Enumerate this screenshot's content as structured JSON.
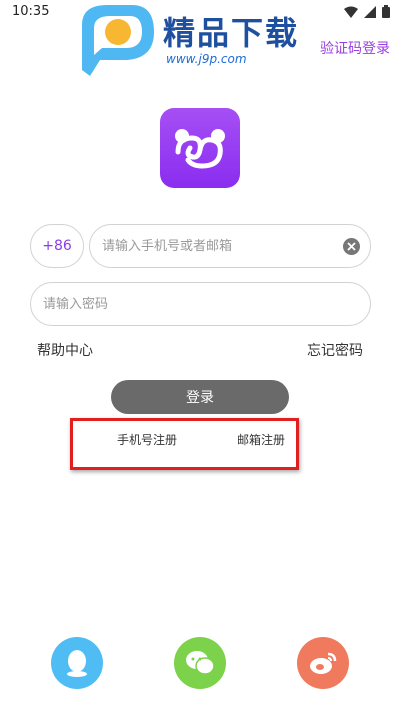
{
  "status_bar": {
    "time": "10:35"
  },
  "watermark": {
    "brand": "精品下载",
    "url": "www.j9p.com"
  },
  "header": {
    "sms_login_link": "验证码登录"
  },
  "form": {
    "country_code": "+86",
    "phone_placeholder": "请输入手机号或者邮箱",
    "password_placeholder": "请输入密码",
    "help_link": "帮助中心",
    "forgot_link": "忘记密码",
    "login_button": "登录"
  },
  "register": {
    "phone": "手机号注册",
    "email": "邮箱注册"
  },
  "colors": {
    "accent": "#9b3fe0",
    "highlight": "#e11f1f",
    "login_button": "#6a6a6a",
    "qq": "#4fbdf4",
    "wechat": "#7cd24a",
    "weibo": "#f07a5d"
  },
  "social": [
    "qq-icon",
    "wechat-icon",
    "weibo-icon"
  ]
}
